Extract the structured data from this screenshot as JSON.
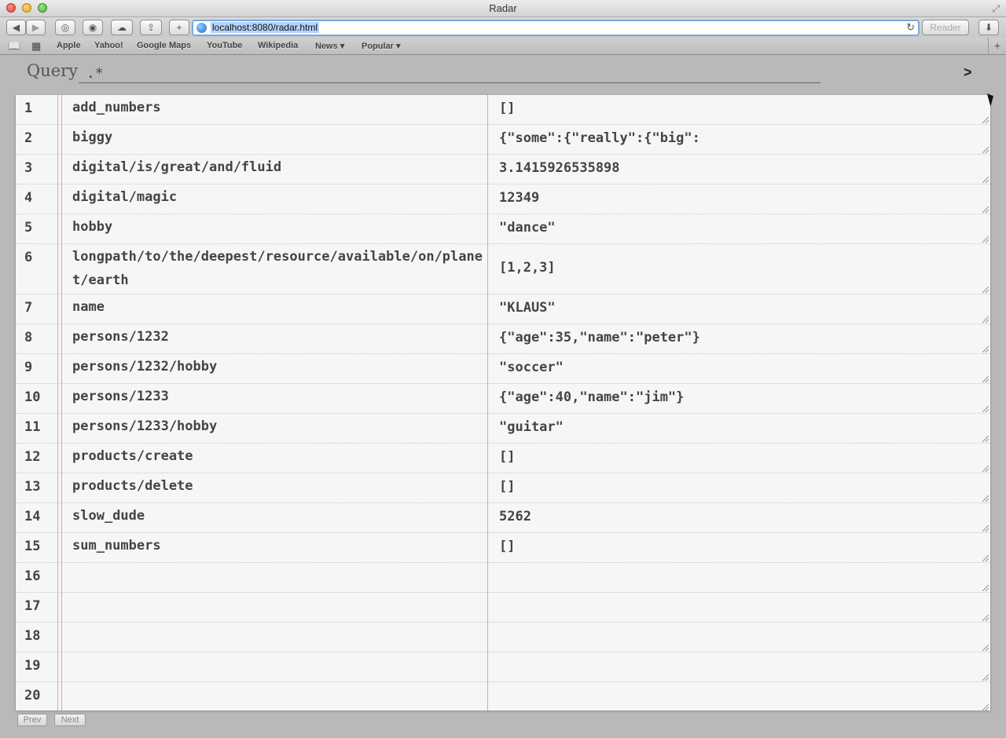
{
  "window": {
    "title": "Radar"
  },
  "toolbar": {
    "url": "localhost:8080/radar.html",
    "reader_label": "Reader"
  },
  "bookmarks": [
    "Apple",
    "Yahoo!",
    "Google Maps",
    "YouTube",
    "Wikipedia",
    "News ▾",
    "Popular ▾"
  ],
  "query": {
    "label": "Query",
    "value": ".*",
    "run_label": ">"
  },
  "rows": [
    {
      "num": "1",
      "key": "add_numbers",
      "value": "[]"
    },
    {
      "num": "2",
      "key": "biggy",
      "value": "{\"some\":{\"really\":{\"big\":"
    },
    {
      "num": "3",
      "key": "digital/is/great/and/fluid",
      "value": "3.1415926535898"
    },
    {
      "num": "4",
      "key": "digital/magic",
      "value": "12349"
    },
    {
      "num": "5",
      "key": "hobby",
      "value": "\"dance\""
    },
    {
      "num": "6",
      "key": "longpath/to/the/deepest/resource/available/on/planet/earth",
      "value": "[1,2,3]"
    },
    {
      "num": "7",
      "key": "name",
      "value": "\"KLAUS\""
    },
    {
      "num": "8",
      "key": "persons/1232",
      "value": "{\"age\":35,\"name\":\"peter\"}"
    },
    {
      "num": "9",
      "key": "persons/1232/hobby",
      "value": "\"soccer\""
    },
    {
      "num": "10",
      "key": "persons/1233",
      "value": "{\"age\":40,\"name\":\"jim\"}"
    },
    {
      "num": "11",
      "key": "persons/1233/hobby",
      "value": "\"guitar\""
    },
    {
      "num": "12",
      "key": "products/create",
      "value": "[]"
    },
    {
      "num": "13",
      "key": "products/delete",
      "value": "[]"
    },
    {
      "num": "14",
      "key": "slow_dude",
      "value": "5262"
    },
    {
      "num": "15",
      "key": "sum_numbers",
      "value": "[]"
    },
    {
      "num": "16",
      "key": "",
      "value": ""
    },
    {
      "num": "17",
      "key": "",
      "value": ""
    },
    {
      "num": "18",
      "key": "",
      "value": ""
    },
    {
      "num": "19",
      "key": "",
      "value": ""
    },
    {
      "num": "20",
      "key": "",
      "value": ""
    }
  ],
  "pager": {
    "prev_label": "Prev",
    "next_label": "Next"
  }
}
